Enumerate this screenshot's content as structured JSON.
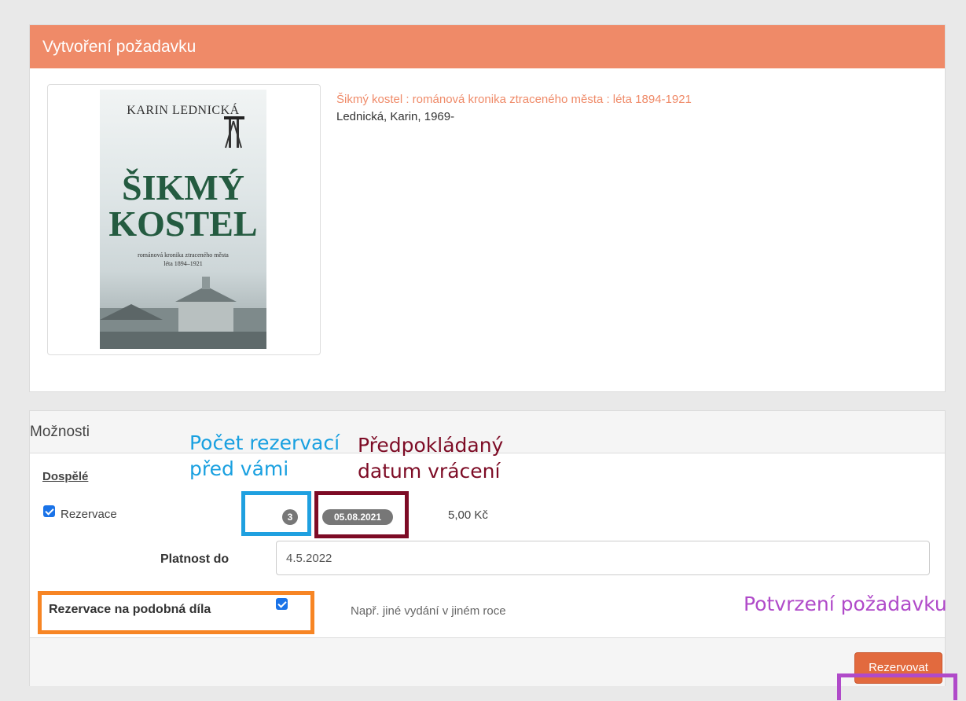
{
  "request_panel": {
    "title": "Vytvoření požadavku",
    "book": {
      "title": "Šikmý kostel : románová kronika ztraceného města : léta 1894-1921",
      "author": "Lednická, Karin, 1969-",
      "cover": {
        "author": "KARIN LEDNICKÁ",
        "title_line1": "ŠIKMÝ",
        "title_line2": "KOSTEL",
        "subtitle_line1": "románová kronika ztraceného města",
        "subtitle_line2": "léta 1894–1921"
      }
    }
  },
  "options_panel": {
    "title": "Možnosti",
    "section": "Dospělé",
    "reservation": {
      "label": "Rezervace",
      "checked": true,
      "queue_count": "3",
      "expected_return_date": "05.08.2021",
      "price": "5,00 Kč"
    },
    "validity": {
      "label": "Platnost do",
      "value": "4.5.2022"
    },
    "similar_works": {
      "label": "Rezervace na podobná díla",
      "checked": true,
      "hint": "Např. jiné vydání v jiném roce"
    },
    "submit_label": "Rezervovat"
  },
  "annotations": {
    "queue": "Počet rezervací\npřed vámi",
    "return_date": "Předpokládaný\ndatum vrácení",
    "confirm": "Potvrzení požadavku",
    "colors": {
      "queue": "#19a0e0",
      "return_date": "#7d0b25",
      "similar": "#f78524",
      "confirm": "#b04ac9"
    }
  },
  "colors": {
    "header_accent": "#ef8a68",
    "button": "#e26a3e"
  }
}
